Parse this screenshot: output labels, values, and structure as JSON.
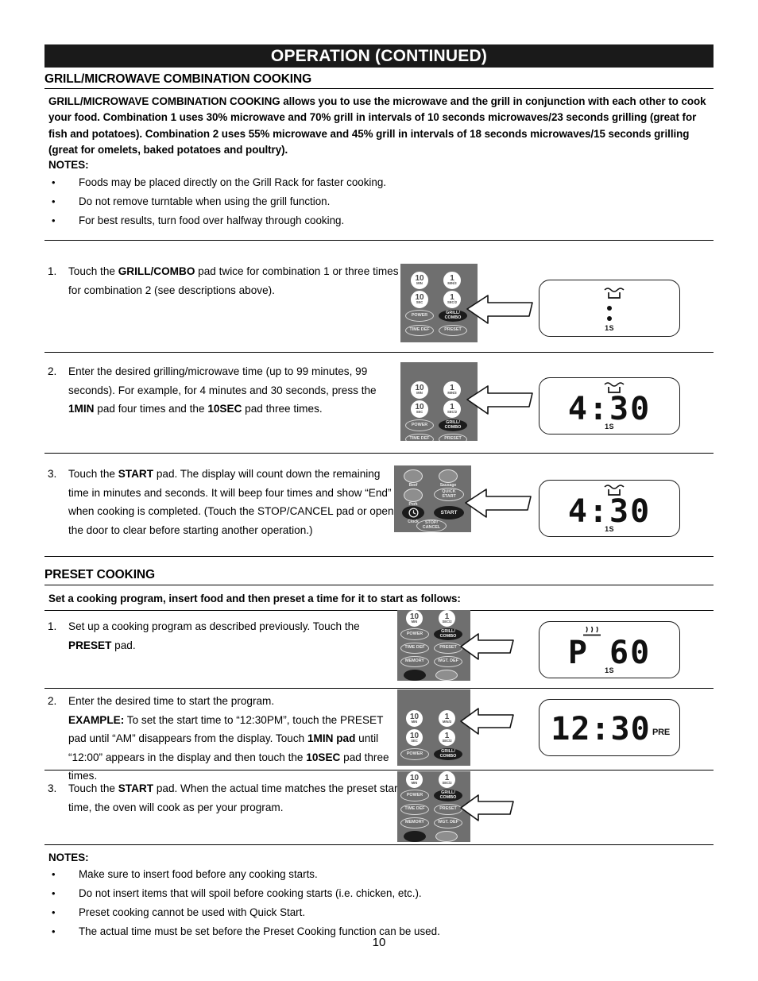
{
  "header": {
    "title": "OPERATION (CONTINUED)"
  },
  "page": {
    "number": "10"
  },
  "section1": {
    "heading": "GRILL/MICROWAVE COMBINATION COOKING",
    "intro": "GRILL/MICROWAVE COMBINATION COOKING allows you to use the microwave and the grill in conjunction with each other to cook your food. Combination 1 uses 30% microwave and 70% grill in intervals of 10 seconds microwaves/23 seconds grilling (great for fish and potatoes). Combination 2 uses 55% microwave and 45% grill in intervals of 18 seconds microwaves/15 seconds grilling (great for omelets, baked potatoes and poultry).",
    "notes_label": "NOTES:",
    "notes": [
      "Foods may be placed directly on the Grill Rack for faster cooking.",
      "Do not remove turntable when using the grill function.",
      "For best results, turn food over halfway through cooking."
    ],
    "steps": [
      {
        "num": "1.",
        "text_html": "Touch the <b>GRILL/COMBO</b> pad twice for combination 1 or three times for combination 2 (see descriptions above).",
        "keypad": {
          "keys": [
            {
              "big": "10",
              "sml": "MIN"
            },
            {
              "big": "1",
              "sml": "MIN/3"
            },
            {
              "big": "10",
              "sml": "SEC"
            },
            {
              "big": "1",
              "sml": "SEC/2"
            },
            {
              "label": "POWER"
            },
            {
              "label": "GRILL/\nCOMBO"
            },
            {
              "label": "TIME DEF"
            },
            {
              "label": "PRESET"
            }
          ],
          "highlight": "GRILL/COMBO"
        },
        "display": {
          "digits": "",
          "colon_only": true,
          "sub": "1S",
          "icon": "grill-icon"
        }
      },
      {
        "num": "2.",
        "text_html": "Enter the desired grilling/microwave time (up to 99 minutes, 99 seconds). For example, for 4 minutes and 30 seconds, press the <b>1MIN</b> pad four times and the <b>10SEC</b> pad three times.",
        "keypad": {
          "keys": [
            {
              "big": "10",
              "sml": "MIN"
            },
            {
              "big": "1",
              "sml": "MIN/3"
            },
            {
              "big": "10",
              "sml": "SEC"
            },
            {
              "big": "1",
              "sml": "SEC/2"
            },
            {
              "label": "POWER"
            },
            {
              "label": "GRILL/\nCOMBO"
            },
            {
              "label": "TIME DEF"
            },
            {
              "label": "PRESET"
            }
          ],
          "highlight": "1MIN"
        },
        "display": {
          "digits": "4:30",
          "sub": "1S",
          "icon": "grill-icon"
        }
      },
      {
        "num": "3.",
        "text_html": "Touch the <b>START</b> pad. The display will count down the remaining time in minutes and seconds. It will beep four times and show “End” when cooking is completed. (Touch the STOP/CANCEL pad or open the door to clear before starting another operation.)",
        "keypad": {
          "keys": [
            {
              "label": "Beef",
              "photo": true
            },
            {
              "label": "Sausage",
              "photo": true
            },
            {
              "label": "Pork",
              "photo": true
            },
            {
              "label": "QUICK\nSTART"
            },
            {
              "label": "Clock"
            },
            {
              "label": "START"
            },
            {
              "label": "STOP/\nCANCEL"
            }
          ],
          "highlight": "START"
        },
        "display": {
          "digits": "4:30",
          "sub": "1S",
          "icon": "grill-icon"
        }
      }
    ]
  },
  "section2": {
    "heading": "PRESET COOKING",
    "subheading": "Set a cooking program, insert food and then preset a time for it to start as follows:",
    "steps": [
      {
        "num": "1.",
        "text_html": "Set up a cooking program as described previously. Touch the <b>PRESET</b> pad.",
        "keypad": {
          "keys": [
            {
              "big": "10",
              "sml": "MIN"
            },
            {
              "big": "1",
              "sml": "SEC/2"
            },
            {
              "label": "POWER"
            },
            {
              "label": "GRILL/\nCOMBO"
            },
            {
              "label": "TIME DEF"
            },
            {
              "label": "PRESET"
            },
            {
              "label": "MEMORY"
            },
            {
              "label": "WGT. DEF"
            }
          ],
          "highlight": "PRESET"
        },
        "display": {
          "digits": "P  60",
          "sub": "1S",
          "icon": "heat-icon"
        }
      },
      {
        "num": "2.",
        "text_html": "Enter the desired time to start the program.<br><b>EXAMPLE:</b> To set the start time to “12:30PM”, touch the PRESET pad until “AM” disappears from the display. Touch <b>1MIN pad</b> until “12:00” appears in the display and then touch  the <b>10SEC</b> pad three times.",
        "keypad": {
          "keys": [
            {
              "big": "10",
              "sml": "MIN"
            },
            {
              "big": "1",
              "sml": "MIN/3"
            },
            {
              "big": "10",
              "sml": "SEC"
            },
            {
              "big": "1",
              "sml": "SEC/2"
            },
            {
              "label": "POWER"
            },
            {
              "label": "GRILL/\nCOMBO"
            }
          ],
          "highlight": "1MIN"
        },
        "display": {
          "digits": "12:30",
          "sub": "",
          "indicator": "PRE"
        }
      },
      {
        "num": "3.",
        "text_html": "Touch the <b>START</b> pad. When the actual time matches the preset start time, the oven will cook as per your program.",
        "keypad": {
          "keys": [
            {
              "big": "10",
              "sml": "MIN"
            },
            {
              "big": "1",
              "sml": "SEC/2"
            },
            {
              "label": "POWER"
            },
            {
              "label": "GRILL/\nCOMBO"
            },
            {
              "label": "TIME DEF"
            },
            {
              "label": "PRESET"
            },
            {
              "label": "MEMORY"
            },
            {
              "label": "WGT. DEF"
            }
          ],
          "highlight": "PRESET"
        },
        "display": null
      }
    ],
    "notes_label": "NOTES:",
    "notes": [
      "Make sure to insert food before any cooking starts.",
      "Do not insert items that will spoil before cooking starts (i.e. chicken, etc.).",
      "Preset cooking cannot be used with Quick Start.",
      "The actual time must be set before the Preset Cooking function can be used."
    ]
  }
}
